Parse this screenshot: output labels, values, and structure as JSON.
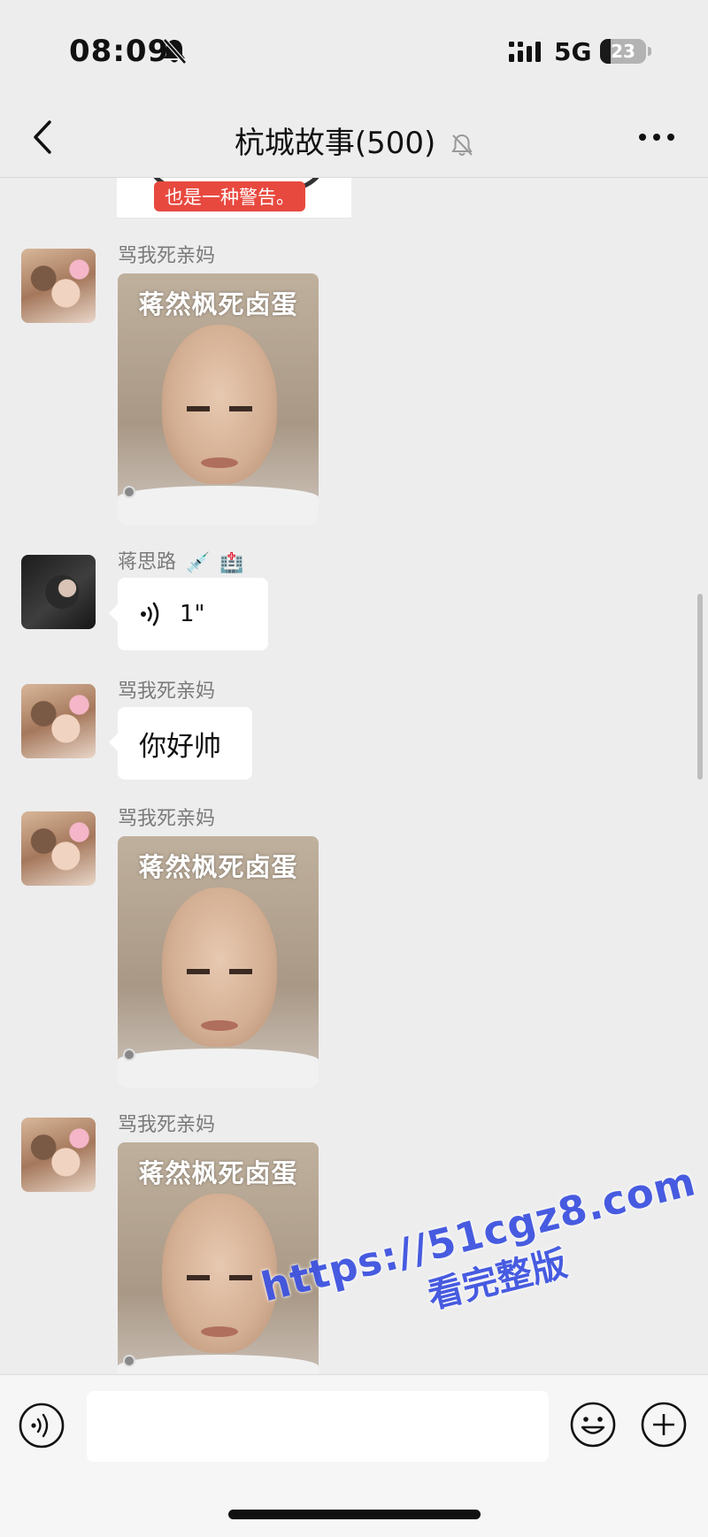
{
  "status_bar": {
    "time": "08:09",
    "network": "5G",
    "battery": "23",
    "icons": [
      "bell-off-icon",
      "signal-icon",
      "battery-icon"
    ]
  },
  "header": {
    "title": "杭城故事(500)",
    "icons": [
      "chevron-left-icon",
      "bell-off-icon",
      "more-dots-icon"
    ]
  },
  "partial_message": {
    "image_text": "也是一种警告。"
  },
  "messages": [
    {
      "sender": "骂我死亲妈",
      "type": "video",
      "caption": "蒋然枫死卤蛋"
    },
    {
      "sender": "蒋思路",
      "sender_emoji": [
        "💉",
        "🏥"
      ],
      "type": "voice",
      "duration": "1\""
    },
    {
      "sender": "骂我死亲妈",
      "type": "text",
      "text": "你好帅"
    },
    {
      "sender": "骂我死亲妈",
      "type": "video",
      "caption": "蒋然枫死卤蛋"
    },
    {
      "sender": "骂我死亲妈",
      "type": "video",
      "caption": "蒋然枫死卤蛋"
    }
  ],
  "input_bar": {
    "placeholder": "",
    "icons": [
      "voice-icon",
      "emoji-icon",
      "plus-icon"
    ]
  },
  "watermark": {
    "url": "https://51cgz8.com",
    "label": "看完整版",
    "color": "#3f54e0"
  },
  "colors": {
    "background": "#ededed",
    "bubble": "#ffffff",
    "sender_name": "#7a7a7a",
    "warning": "#e8493f"
  }
}
